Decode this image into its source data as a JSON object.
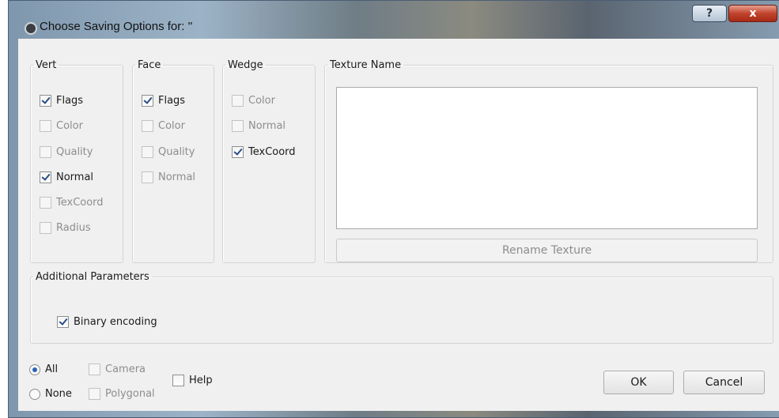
{
  "window": {
    "title": "Choose Saving Options for: ''",
    "help_symbol": "?",
    "close_symbol": "x"
  },
  "vert": {
    "legend": "Vert",
    "options": [
      {
        "label": "Flags",
        "checked": true,
        "enabled": true
      },
      {
        "label": "Color",
        "checked": false,
        "enabled": false
      },
      {
        "label": "Quality",
        "checked": false,
        "enabled": false
      },
      {
        "label": "Normal",
        "checked": true,
        "enabled": true
      },
      {
        "label": "TexCoord",
        "checked": false,
        "enabled": false
      },
      {
        "label": "Radius",
        "checked": false,
        "enabled": false
      }
    ]
  },
  "face": {
    "legend": "Face",
    "options": [
      {
        "label": "Flags",
        "checked": true,
        "enabled": true
      },
      {
        "label": "Color",
        "checked": false,
        "enabled": false
      },
      {
        "label": "Quality",
        "checked": false,
        "enabled": false
      },
      {
        "label": "Normal",
        "checked": false,
        "enabled": false
      }
    ]
  },
  "wedge": {
    "legend": "Wedge",
    "options": [
      {
        "label": "Color",
        "checked": false,
        "enabled": false
      },
      {
        "label": "Normal",
        "checked": false,
        "enabled": false
      },
      {
        "label": "TexCoord",
        "checked": true,
        "enabled": true
      }
    ]
  },
  "texture": {
    "legend": "Texture Name",
    "rename_label": "Rename Texture"
  },
  "additional": {
    "legend": "Additional Parameters",
    "binary_label": "Binary encoding",
    "binary_checked": true
  },
  "footer": {
    "all_label": "All",
    "none_label": "None",
    "camera_label": "Camera",
    "polygonal_label": "Polygonal",
    "help_label": "Help",
    "ok_label": "OK",
    "cancel_label": "Cancel"
  }
}
